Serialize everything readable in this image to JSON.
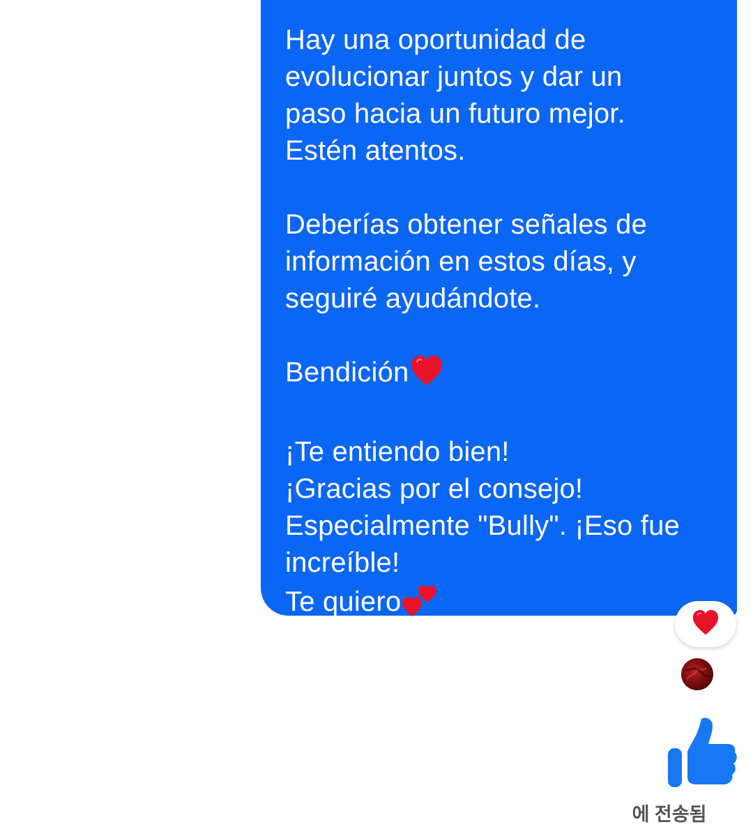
{
  "message": {
    "lines_p1": [
      "Hay una oportunidad de",
      "evolucionar juntos y dar un",
      "paso hacia un futuro mejor.",
      "Estén atentos."
    ],
    "lines_p2": [
      "Deberías obtener señales de",
      "información en estos días, y",
      "seguiré ayudándote."
    ],
    "blessing": "Bendición",
    "lines_p4": [
      "¡Te entiendo bien!",
      "¡Gracias por el consejo!",
      "Especialmente \"Bully\". ¡Eso fue",
      "increíble!"
    ],
    "closing": "Te quiero"
  },
  "reaction": {
    "icon": "heart-icon",
    "color": "#e8132b"
  },
  "read_receipt": {
    "icon": "avatar"
  },
  "like_button": {
    "icon": "thumbs-up-icon",
    "color": "#1877f2"
  },
  "status_text": "에 전송됨",
  "colors": {
    "bubble": "#0a66f5",
    "bubble_text": "#ffffff",
    "status_text": "#555555"
  }
}
